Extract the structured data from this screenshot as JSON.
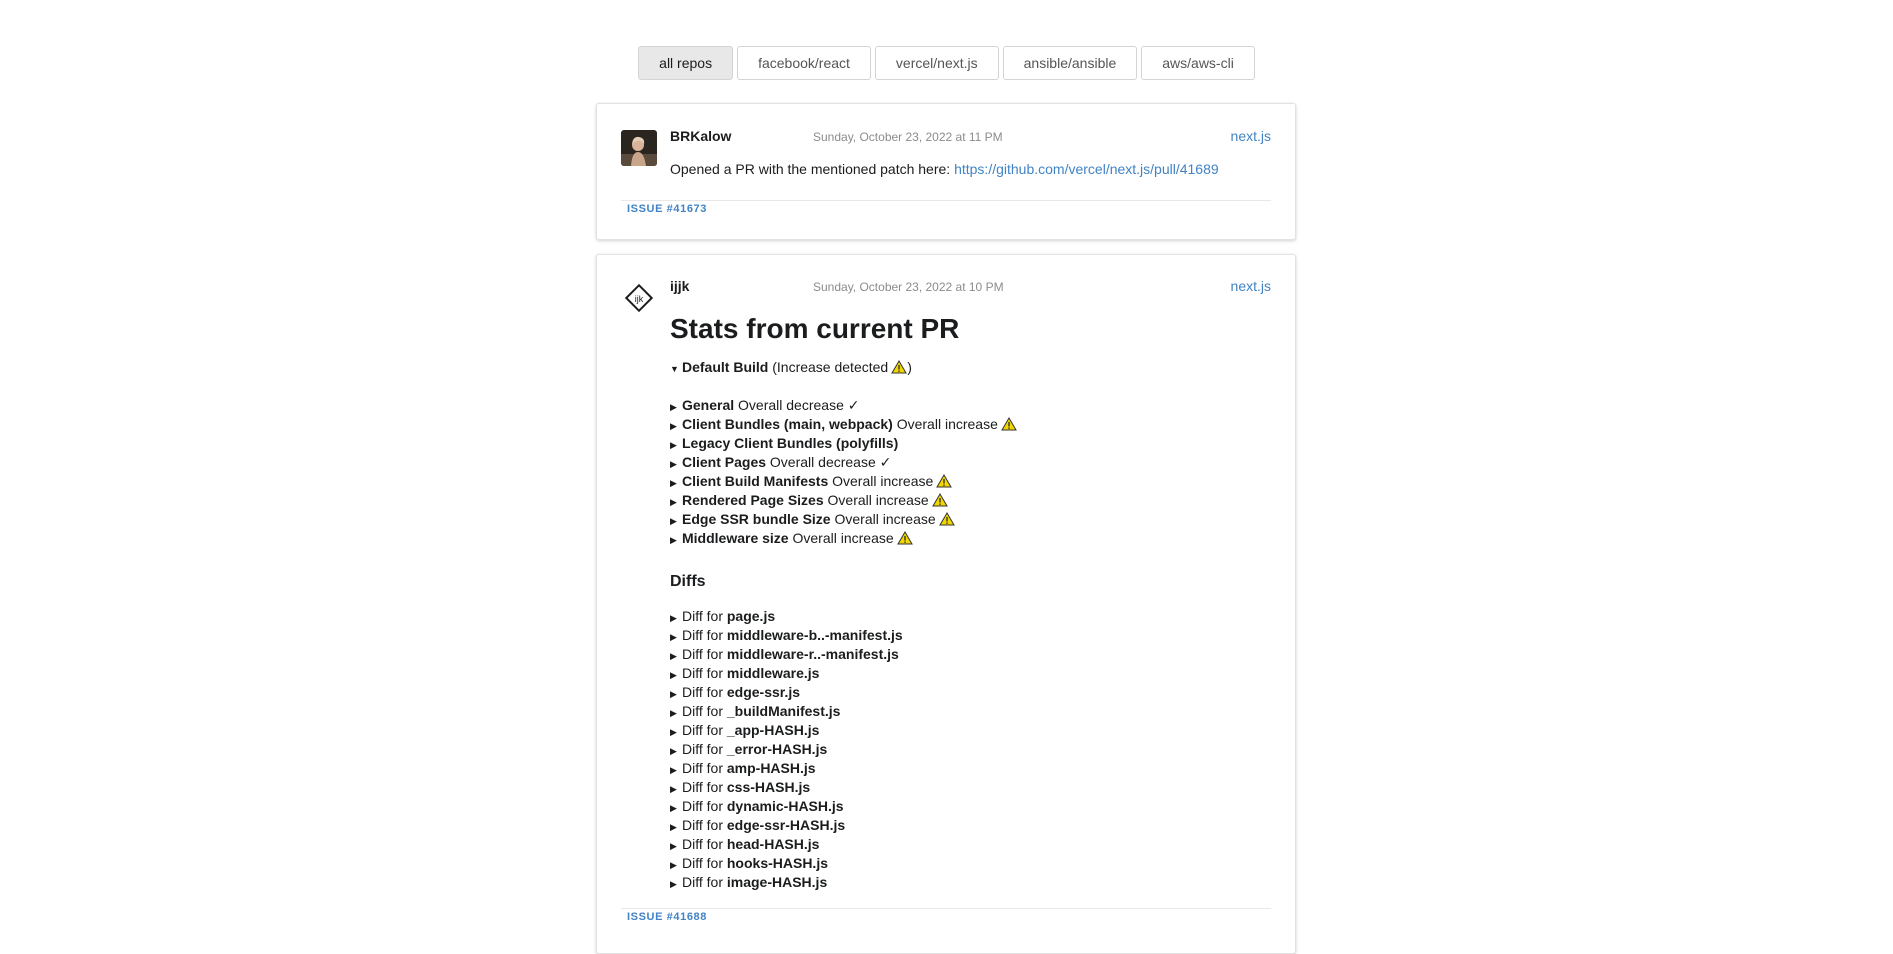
{
  "repo_tabs": [
    "all repos",
    "facebook/react",
    "vercel/next.js",
    "ansible/ansible",
    "aws/aws-cli"
  ],
  "colors": {
    "link": "#4183c4",
    "warning": "#f2d600"
  },
  "comments": [
    {
      "author": "BRKalow",
      "date": "Sunday, October 23, 2022 at 11 PM",
      "repo": "next.js",
      "text_prefix": "Opened a PR with the mentioned patch here: ",
      "link": "https://github.com/vercel/next.js/pull/41689",
      "issue": "ISSUE #41673"
    },
    {
      "author": "ijjk",
      "date": "Sunday, October 23, 2022 at 10 PM",
      "repo": "next.js",
      "heading": "Stats from current PR",
      "default_build": {
        "label": "Default Build",
        "note_open": "(Increase detected",
        "note_close": ")"
      },
      "metrics": [
        {
          "name": "General",
          "status": "Overall decrease ✓",
          "warn": false
        },
        {
          "name": "Client Bundles (main, webpack)",
          "status": "Overall increase",
          "warn": true
        },
        {
          "name": "Legacy Client Bundles (polyfills)",
          "status": "",
          "warn": false
        },
        {
          "name": "Client Pages",
          "status": "Overall decrease ✓",
          "warn": false
        },
        {
          "name": "Client Build Manifests",
          "status": "Overall increase",
          "warn": true
        },
        {
          "name": "Rendered Page Sizes",
          "status": "Overall increase",
          "warn": true
        },
        {
          "name": "Edge SSR bundle Size",
          "status": "Overall increase",
          "warn": true
        },
        {
          "name": "Middleware size",
          "status": "Overall increase",
          "warn": true
        }
      ],
      "diffs_heading": "Diffs",
      "diff_prefix": "Diff for",
      "diff_files": [
        "page.js",
        "middleware-b..-manifest.js",
        "middleware-r..-manifest.js",
        "middleware.js",
        "edge-ssr.js",
        "_buildManifest.js",
        "_app-HASH.js",
        "_error-HASH.js",
        "amp-HASH.js",
        "css-HASH.js",
        "dynamic-HASH.js",
        "edge-ssr-HASH.js",
        "head-HASH.js",
        "hooks-HASH.js",
        "image-HASH.js"
      ],
      "issue": "ISSUE #41688"
    }
  ]
}
